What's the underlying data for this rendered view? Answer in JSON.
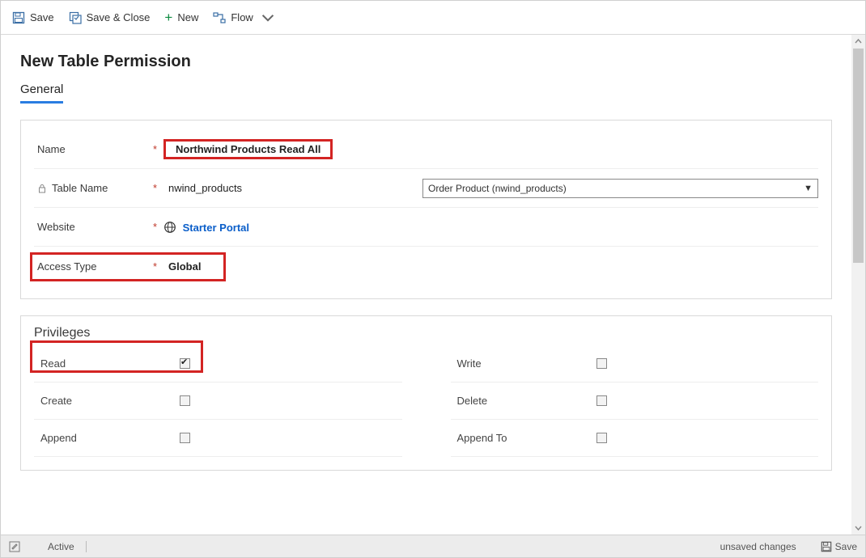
{
  "commands": {
    "save": "Save",
    "save_close": "Save & Close",
    "new": "New",
    "flow": "Flow"
  },
  "page": {
    "title": "New Table Permission",
    "tab_general": "General"
  },
  "general": {
    "name_label": "Name",
    "name_value": "Northwind Products Read All",
    "table_label": "Table Name",
    "table_value": "nwind_products",
    "table_dropdown": "Order Product (nwind_products)",
    "website_label": "Website",
    "website_value": "Starter Portal",
    "access_label": "Access Type",
    "access_value": "Global"
  },
  "privileges": {
    "title": "Privileges",
    "read": "Read",
    "write": "Write",
    "create": "Create",
    "delete": "Delete",
    "append": "Append",
    "append_to": "Append To"
  },
  "footer": {
    "status": "Active",
    "unsaved": "unsaved changes",
    "save": "Save"
  }
}
